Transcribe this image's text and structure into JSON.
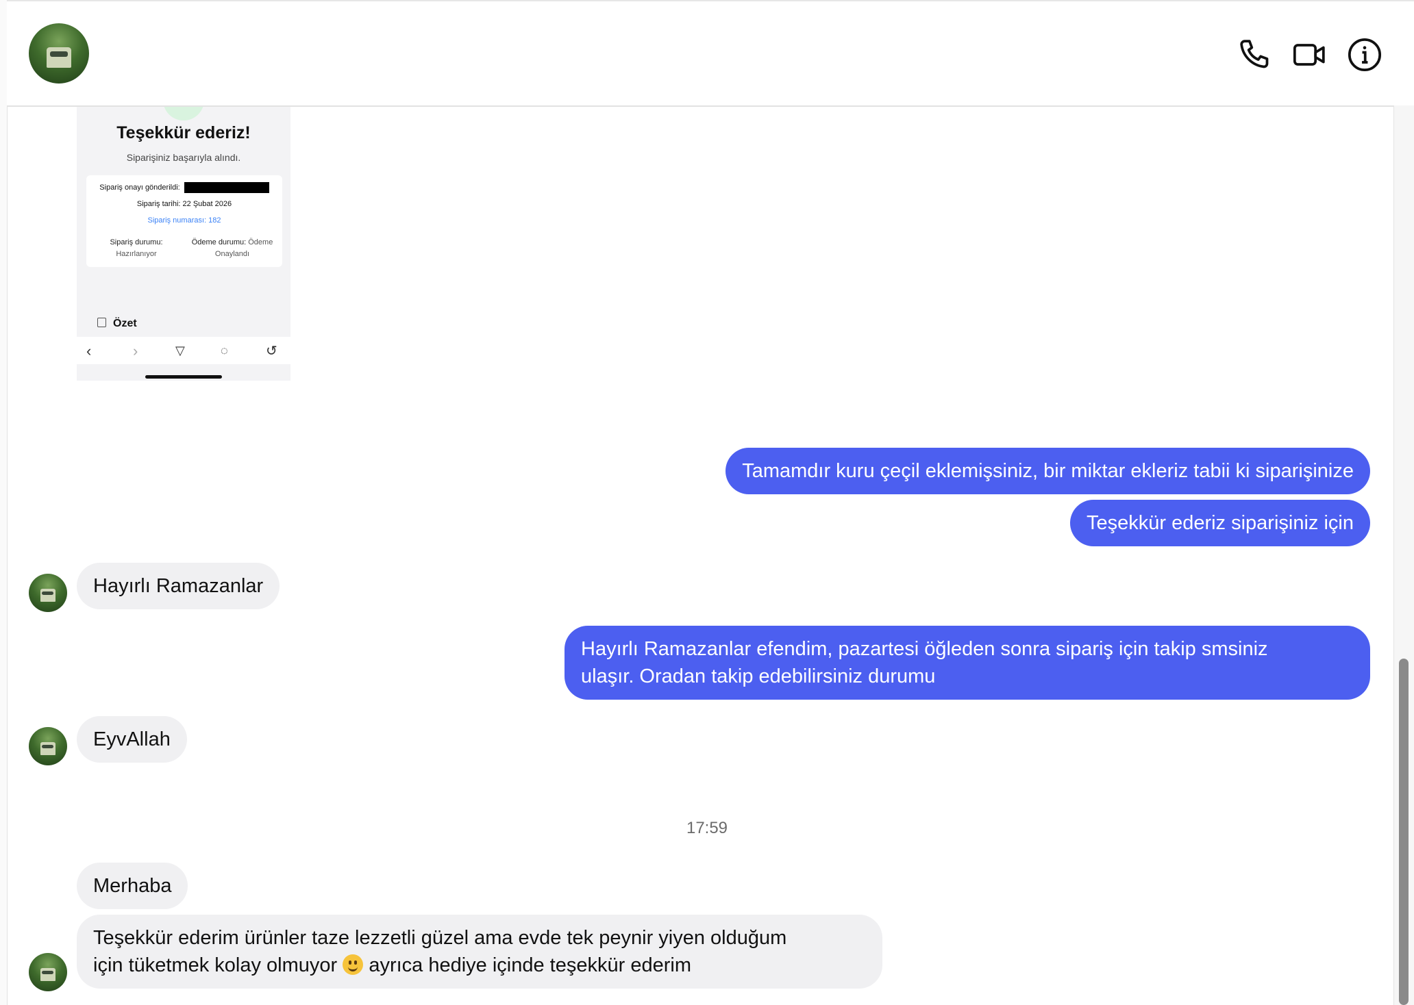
{
  "header": {
    "call_label": "Sesli arama",
    "video_label": "Görüntülü arama",
    "info_label": "Bilgi"
  },
  "screenshot": {
    "title": "Teşekkür ederiz!",
    "subtitle": "Siparişiniz başarıyla alındı.",
    "confirm_label": "Sipariş onayı gönderildi:",
    "date_line": "Sipariş tarihi: 22 Şubat 2026",
    "order_number_line": "Sipariş numarası: 182",
    "order_status_label": "Sipariş durumu:",
    "order_status_value": "Hazırlanıyor",
    "payment_status_label": "Ödeme durumu:",
    "payment_status_value_1": "Ödeme",
    "payment_status_value_2": "Onaylandı",
    "summary_label": "Özet"
  },
  "messages": [
    {
      "side": "out",
      "text": "Tamamdır kuru çeçil eklemişsiniz, bir miktar ekleriz tabii ki siparişinize"
    },
    {
      "side": "out",
      "text": "Teşekkür ederiz siparişiniz için"
    },
    {
      "side": "in",
      "text": "Hayırlı Ramazanlar"
    },
    {
      "side": "out",
      "text_line1": "Hayırlı Ramazanlar efendim, pazartesi öğleden sonra sipariş için takip smsiniz",
      "text_line2": "ulaşır. Oradan takip edebilirsiniz durumu"
    },
    {
      "side": "in",
      "text": "EyvAllah"
    },
    {
      "side": "in",
      "text": "Merhaba"
    },
    {
      "side": "in",
      "text_line1": "Teşekkür ederim ürünler taze lezzetli güzel ama evde tek peynir yiyen olduğum",
      "text_line2_a": "için tüketmek kolay olmuyor",
      "text_line2_b": "ayrıca hediye içinde teşekkür ederim"
    }
  ],
  "timestamp": "17:59",
  "colors": {
    "outgoing_bubble": "#4c5ff0",
    "incoming_bubble": "#f0f0f2"
  }
}
